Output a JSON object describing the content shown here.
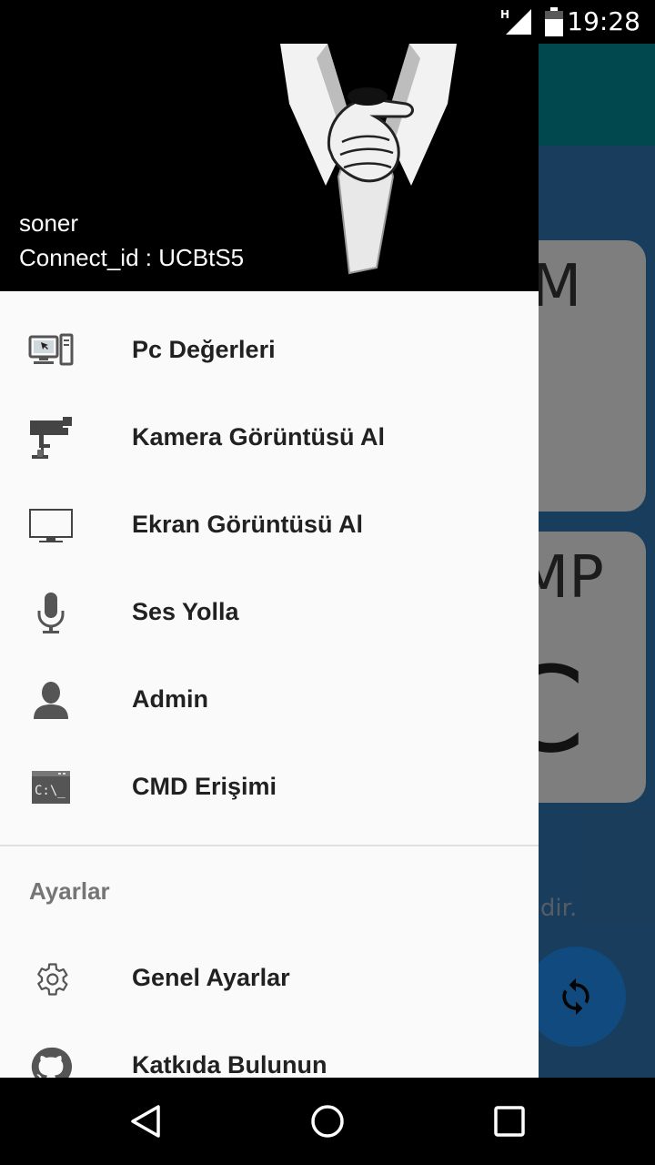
{
  "status_bar": {
    "time": "19:28",
    "network_badge": "H",
    "signal_icon": "signal-icon",
    "battery_icon": "battery-icon"
  },
  "background_app": {
    "card1_text": "M",
    "card2_text": "MP",
    "card2_big_text": "C",
    "info_text": "eridir.",
    "fab_icon": "refresh-icon"
  },
  "drawer": {
    "header": {
      "user_name": "soner",
      "connect_id": "Connect_id : UCBtS5",
      "art_icon": "anonymous-hand-tie-icon"
    },
    "menu_items": [
      {
        "label": "Pc Değerleri",
        "icon": "computer-icon"
      },
      {
        "label": "Kamera Görüntüsü Al",
        "icon": "security-camera-icon"
      },
      {
        "label": "Ekran Görüntüsü Al",
        "icon": "monitor-icon"
      },
      {
        "label": "Ses Yolla",
        "icon": "microphone-icon"
      },
      {
        "label": "Admin",
        "icon": "user-icon"
      },
      {
        "label": "CMD Erişimi",
        "icon": "terminal-icon"
      }
    ],
    "section_title": "Ayarlar",
    "settings_items": [
      {
        "label": "Genel Ayarlar",
        "icon": "gear-icon"
      },
      {
        "label": "Katkıda Bulunun",
        "icon": "github-icon"
      }
    ]
  },
  "nav_bar": {
    "back_icon": "back-icon",
    "home_icon": "home-icon",
    "recents_icon": "recents-icon"
  },
  "colors": {
    "drawer_bg": "#fafafa",
    "header_bg": "#000000",
    "app_toolbar": "#00838f",
    "app_bg": "#2f6fa8",
    "fab": "#1e88e5"
  }
}
